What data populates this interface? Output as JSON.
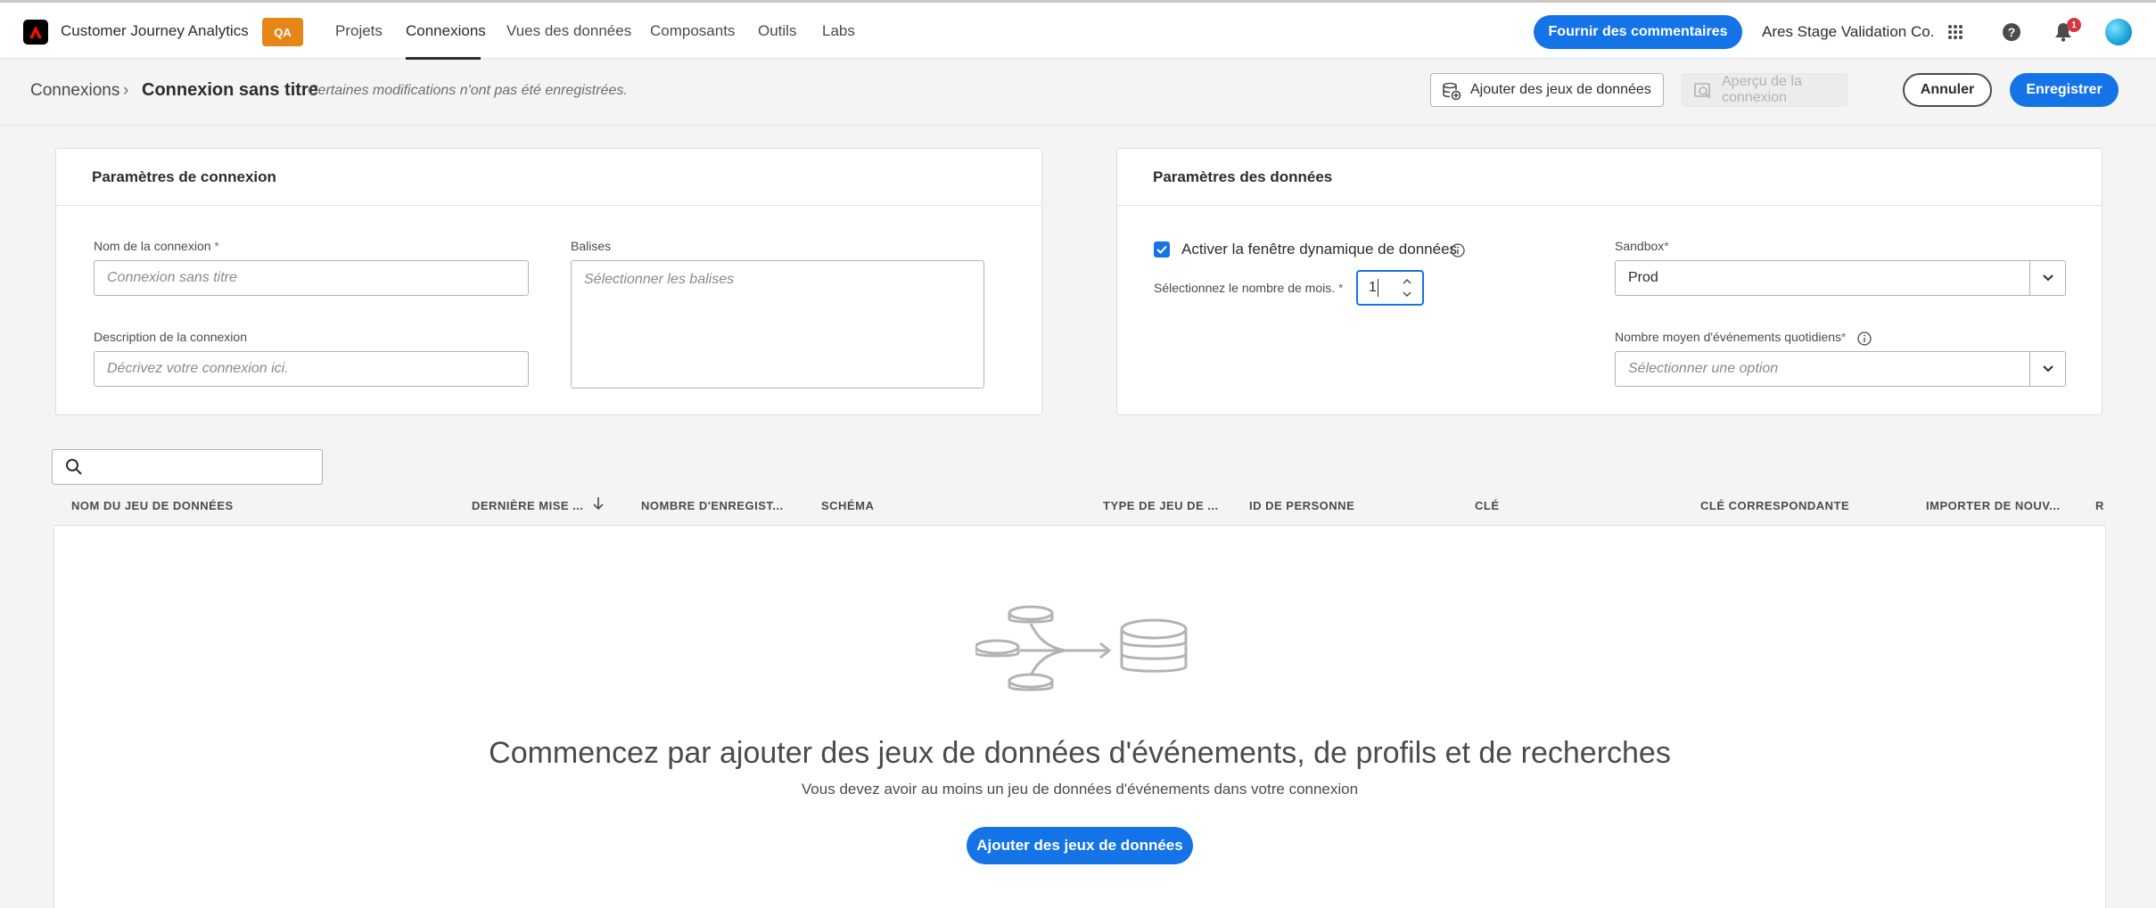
{
  "topbar": {
    "app_title": "Customer Journey Analytics",
    "env_badge": "QA",
    "nav": [
      "Projets",
      "Connexions",
      "Vues des données",
      "Composants",
      "Outils",
      "Labs"
    ],
    "active_nav": "Connexions",
    "feedback_label": "Fournir des commentaires",
    "org_name": "Ares Stage Validation Co.",
    "notification_count": "1",
    "icons": [
      "adobe-logo-icon",
      "apps-grid-icon",
      "help-icon",
      "bell-icon",
      "avatar"
    ]
  },
  "subbar": {
    "breadcrumb_root": "Connexions",
    "breadcrumb_sep": "›",
    "breadcrumb_current": "Connexion sans titre",
    "unsaved_note": "Certaines modifications n'ont pas été enregistrées.",
    "add_datasets_label": "Ajouter des jeux de données",
    "preview_label": "Aperçu de la connexion",
    "cancel_label": "Annuler",
    "save_label": "Enregistrer"
  },
  "connection_settings": {
    "title": "Paramètres de connexion",
    "name_label": "Nom de la connexion",
    "name_placeholder": "Connexion sans titre",
    "tags_label": "Balises",
    "tags_placeholder": "Sélectionner les balises",
    "description_label": "Description de la connexion",
    "description_placeholder": "Décrivez votre connexion ici.",
    "required_mark": "*"
  },
  "data_settings": {
    "title": "Paramètres des données",
    "rolling_window_label": "Activer la fenêtre dynamique de données",
    "rolling_window_checked": true,
    "months_label": "Sélectionnez le nombre de mois.",
    "months_value": "1",
    "sandbox_label": "Sandbox",
    "sandbox_value": "Prod",
    "avg_events_label": "Nombre moyen d'événements quotidiens",
    "avg_events_placeholder": "Sélectionner une option",
    "required_mark": "*"
  },
  "table": {
    "search_placeholder": "",
    "columns": [
      "NOM DU JEU DE DONNÉES",
      "DERNIÈRE MISE ...",
      "NOMBRE D'ENREGIST...",
      "SCHÉMA",
      "TYPE DE JEU DE ...",
      "ID DE PERSONNE",
      "CLÉ",
      "CLÉ CORRESPONDANTE",
      "IMPORTER DE NOUV...",
      "R"
    ],
    "empty_title": "Commencez par ajouter des jeux de données d'événements, de profils et de recherches",
    "empty_subtitle": "Vous devez avoir au moins un jeu de données d'événements dans votre connexion",
    "empty_button": "Ajouter des jeux de données"
  },
  "colors": {
    "accent": "#1473e6",
    "badge": "#e68619",
    "notification": "#d7373f"
  }
}
